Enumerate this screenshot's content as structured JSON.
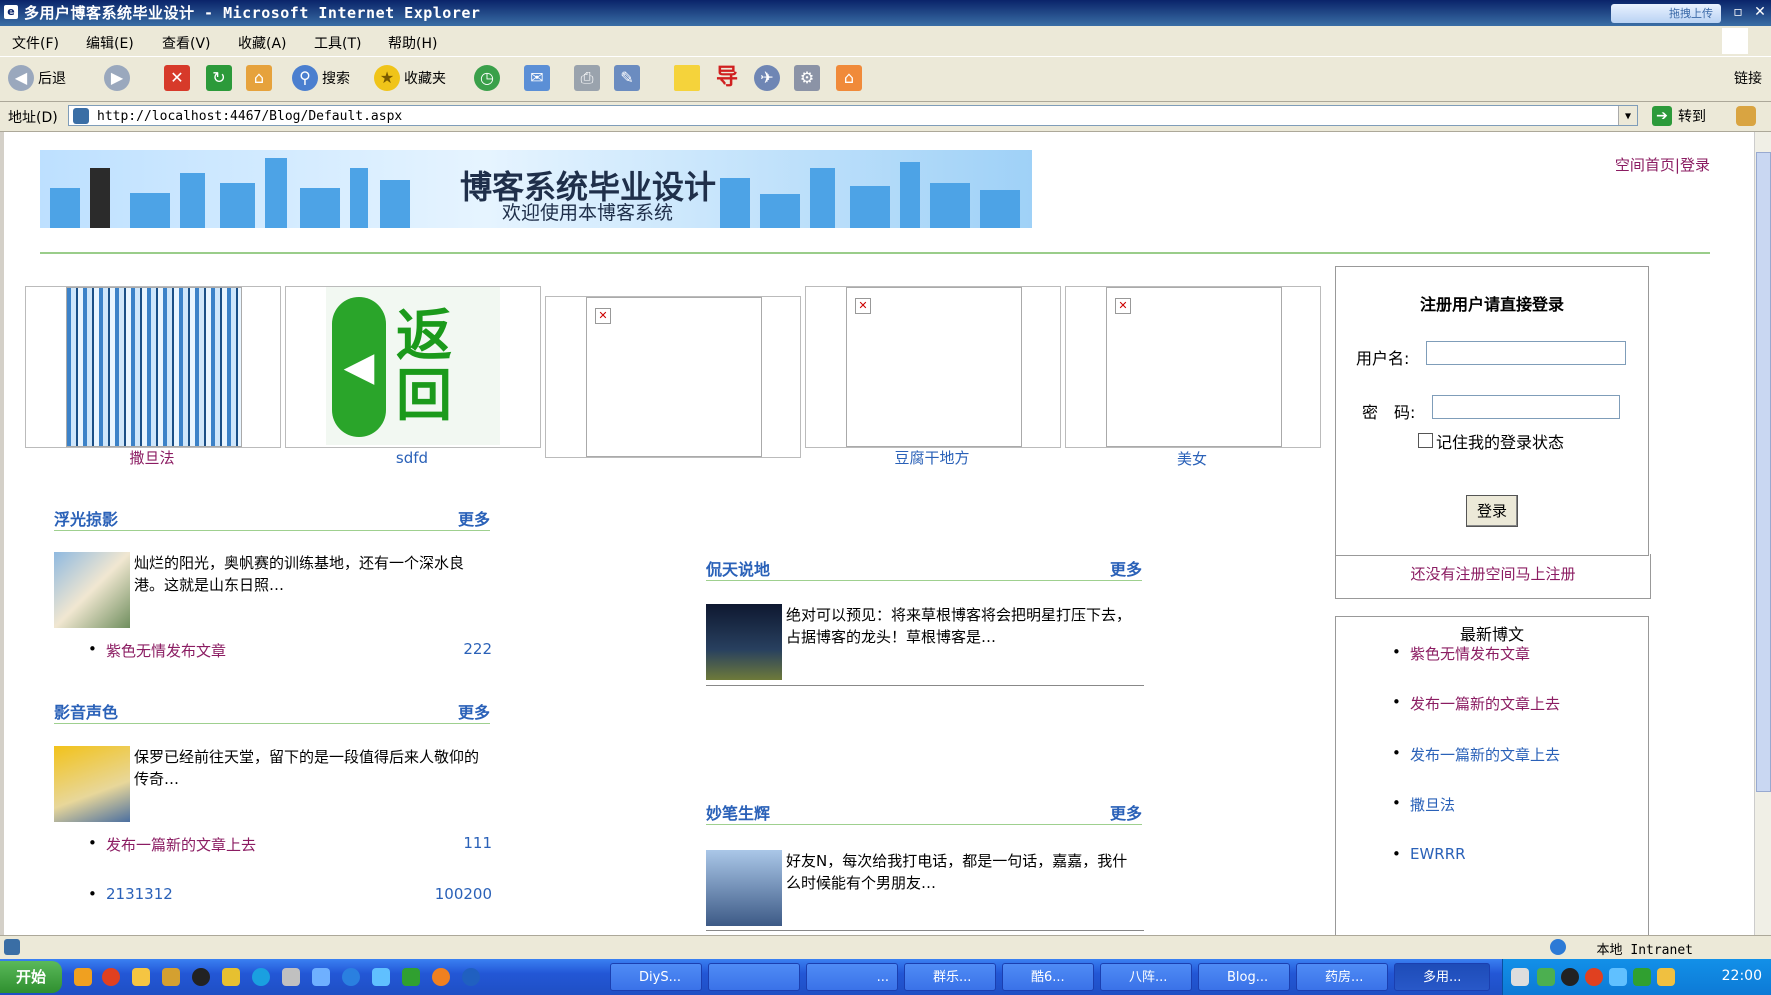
{
  "window": {
    "title": "多用户博客系统毕业设计 - Microsoft Internet Explorer",
    "upload_button": "拖拽上传"
  },
  "menu": [
    "文件(F)",
    "编辑(E)",
    "查看(V)",
    "收藏(A)",
    "工具(T)",
    "帮助(H)"
  ],
  "toolbar": {
    "back": "后退",
    "search": "搜索",
    "favorites": "收藏夹",
    "links": "链接"
  },
  "address": {
    "label": "地址(D)",
    "url": "http://localhost:4467/Blog/Default.aspx",
    "go": "转到"
  },
  "banner": {
    "title": "博客系统毕业设计",
    "subtitle": "欢迎使用本博客系统"
  },
  "top_links": {
    "home": "空间首页",
    "sep": "|",
    "login": "登录"
  },
  "gallery": [
    {
      "caption": "撒旦法"
    },
    {
      "caption": "sdfd"
    },
    {
      "caption": ""
    },
    {
      "caption": "豆腐干地方"
    },
    {
      "caption": "美女"
    }
  ],
  "sections": {
    "fuguang": {
      "title": "浮光掠影",
      "more": "更多",
      "article_text": "灿烂的阳光，奥帆赛的训练基地，还有一个深水良港。这就是山东日照…",
      "items": [
        {
          "label": "紫色无情发布文章",
          "count": "222"
        }
      ]
    },
    "yinyin": {
      "title": "影音声色",
      "more": "更多",
      "article_text": "保罗已经前往天堂，留下的是一段值得后来人敬仰的传奇…",
      "items": [
        {
          "label": "发布一篇新的文章上去",
          "count": "111"
        },
        {
          "label": "2131312",
          "count": "100200"
        }
      ]
    },
    "kantian": {
      "title": "侃天说地",
      "more": "更多",
      "article_text": "绝对可以预见：将来草根博客将会把明星打压下去，占据博客的龙头！草根博客是…"
    },
    "miaobi": {
      "title": "妙笔生辉",
      "more": "更多",
      "article_text": "好友N，每次给我打电话，都是一句话，嘉嘉，我什么时候能有个男朋友…"
    }
  },
  "login": {
    "title": "注册用户请直接登录",
    "username_label": "用户名:",
    "password_label": "密　码:",
    "remember_label": "记住我的登录状态",
    "button": "登录",
    "register_link": "还没有注册空间马上注册"
  },
  "latest": {
    "title": "最新博文",
    "items": [
      "紫色无情发布文章",
      "发布一篇新的文章上去",
      "发布一篇新的文章上去",
      "撒旦法",
      "EWRRR"
    ]
  },
  "status": {
    "zone": "本地 Intranet"
  },
  "taskbar": {
    "start": "开始",
    "tasks": [
      "DiyS...",
      "",
      "...",
      "群乐...",
      "酷6...",
      "八阵...",
      "Blog...",
      "药房...",
      "多用..."
    ],
    "clock": "22:00"
  }
}
